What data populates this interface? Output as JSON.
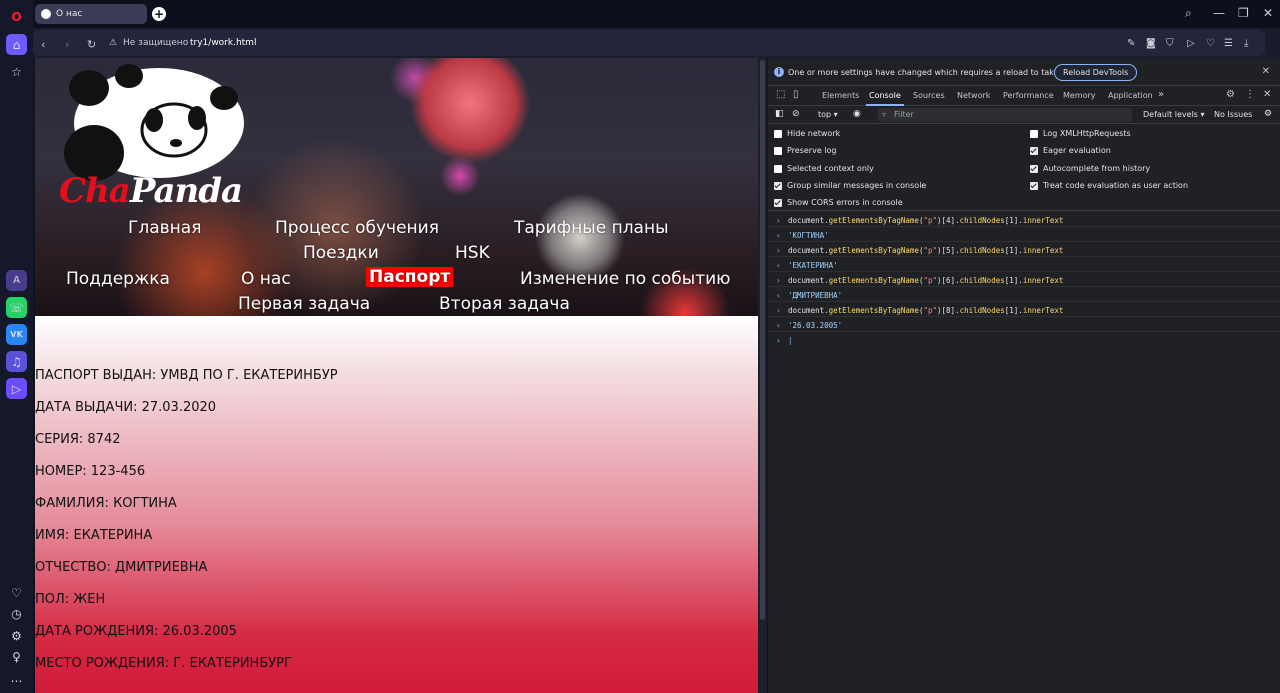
{
  "browser": {
    "tab_title": "О нас",
    "new_tab": "+",
    "security_label": "Не защищено",
    "url": "try1/work.html"
  },
  "sidebar": {
    "items": [
      {
        "name": "opera-logo-icon",
        "glyph": "O"
      },
      {
        "name": "home-icon",
        "glyph": "⌂"
      },
      {
        "name": "star-icon",
        "glyph": "☆"
      },
      {
        "name": "aria-icon",
        "glyph": "A"
      },
      {
        "name": "whatsapp-icon",
        "glyph": "☏"
      },
      {
        "name": "vk-icon",
        "glyph": "VK"
      },
      {
        "name": "music-icon",
        "glyph": "♫"
      },
      {
        "name": "player-icon",
        "glyph": "▷"
      },
      {
        "name": "heart-icon",
        "glyph": "♡"
      },
      {
        "name": "history-icon",
        "glyph": "◷"
      },
      {
        "name": "settings-icon",
        "glyph": "⚙"
      },
      {
        "name": "tips-icon",
        "glyph": "♀"
      },
      {
        "name": "more-icon",
        "glyph": "…"
      }
    ]
  },
  "site": {
    "brand_part1": "Cha",
    "brand_part2": "Panda",
    "nav": {
      "home": "Главная",
      "learning": "Процесс обучения",
      "tariffs": "Тарифные планы",
      "trips": "Поездки",
      "hsk": "HSK",
      "support": "Поддержка",
      "about": "О нас",
      "passport": "Паспорт",
      "event_change": "Изменение по событию",
      "task1": "Первая задача",
      "task2": "Вторая задача"
    },
    "passport_fields": [
      "ПАСПОРТ ВЫДАН: УМВД ПО Г. ЕКАТЕРИНБУР",
      "ДАТА ВЫДАЧИ: 27.03.2020",
      "СЕРИЯ: 8742",
      "НОМЕР: 123-456",
      "ФАМИЛИЯ: КОГТИНА",
      "ИМЯ: ЕКАТЕРИНА",
      "ОТЧЕСТВО: ДМИТРИЕВНА",
      "ПОЛ: ЖЕН",
      "ДАТА РОЖДЕНИЯ: 26.03.2005",
      "МЕСТО РОЖДЕНИЯ: Г. ЕКАТЕРИНБУРГ"
    ]
  },
  "devtools": {
    "info_message": "One or more settings have changed which requires a reload to take effect.",
    "reload_button": "Reload DevTools",
    "tabs": [
      "Elements",
      "Console",
      "Sources",
      "Network",
      "Performance",
      "Memory",
      "Application"
    ],
    "active_tab": "Console",
    "more_tabs": "»",
    "context": "top",
    "filter_placeholder": "Filter",
    "levels": "Default levels",
    "issues": "No Issues",
    "settings_left": [
      {
        "label": "Hide network",
        "checked": false
      },
      {
        "label": "Preserve log",
        "checked": false
      },
      {
        "label": "Selected context only",
        "checked": false
      },
      {
        "label": "Group similar messages in console",
        "checked": true
      },
      {
        "label": "Show CORS errors in console",
        "checked": true
      }
    ],
    "settings_right": [
      {
        "label": "Log XMLHttpRequests",
        "checked": false
      },
      {
        "label": "Eager evaluation",
        "checked": true
      },
      {
        "label": "Autocomplete from history",
        "checked": true
      },
      {
        "label": "Treat code evaluation as user action",
        "checked": true
      }
    ],
    "console": [
      {
        "kind": "input",
        "pre": "document.",
        "fn": "getElementsByTagName",
        "arg": "\"p\"",
        "rest": "[4].",
        "p1": "childNodes",
        "mid": "[1].",
        "p2": "innerText"
      },
      {
        "kind": "output",
        "text": "'КОГТИНА'"
      },
      {
        "kind": "input",
        "pre": "document.",
        "fn": "getElementsByTagName",
        "arg": "\"p\"",
        "rest": "[5].",
        "p1": "childNodes",
        "mid": "[1].",
        "p2": "innerText"
      },
      {
        "kind": "output",
        "text": "'ЕКАТЕРИНА'"
      },
      {
        "kind": "input",
        "pre": "document.",
        "fn": "getElementsByTagName",
        "arg": "\"p\"",
        "rest": "[6].",
        "p1": "childNodes",
        "mid": "[1].",
        "p2": "innerText"
      },
      {
        "kind": "output",
        "text": "'ДМИТРИЕВНА'"
      },
      {
        "kind": "input",
        "pre": "document.",
        "fn": "getElementsByTagName",
        "arg": "\"p\"",
        "rest": "[8].",
        "p1": "childNodes",
        "mid": "[1].",
        "p2": "innerText"
      },
      {
        "kind": "output",
        "text": "'26.03.2005'"
      }
    ],
    "prompt": "›"
  },
  "colors": {
    "accent_red": "#ff0000",
    "devtools_blue": "#8ab4f8"
  }
}
